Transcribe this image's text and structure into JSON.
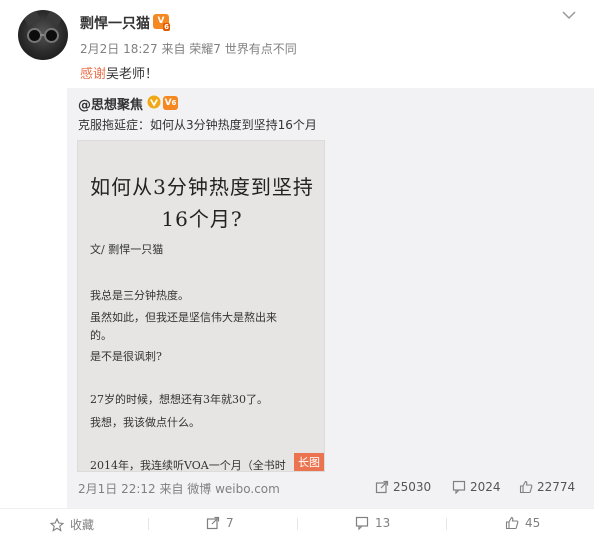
{
  "post": {
    "author": "剽悍一只猫",
    "vip_level": "6",
    "meta": "2月2日 18:27 来自 荣耀7 世界有点不同",
    "text_link": "感谢",
    "text_rest": "吴老师！"
  },
  "repost": {
    "author": "@思想聚焦",
    "vip_level": "6",
    "text": "克服拖延症：如何从3分钟热度到坚持16个月",
    "image": {
      "title_line1": "如何从3分钟热度到坚持",
      "title_line2": "16个月?",
      "lines": [
        "文/ 剽悍一只猫",
        "我总是三分钟热度。",
        "虽然如此，但我还是坚信伟大是熬出来",
        "的。",
        "是不是很讽刺?",
        "27岁的时候，想想还有3年就30了。",
        "我想，我该做点什么。",
        "2014年，我连续听VOA一个月（全书时"
      ],
      "tag": "长图"
    },
    "meta": "2月1日 22:12 来自 微博 weibo.com",
    "reposts": "25030",
    "comments": "2024",
    "likes": "22774"
  },
  "actions": {
    "favorite": "收藏",
    "repost": "7",
    "comment": "13",
    "like": "45"
  },
  "colors": {
    "link": "#eb7350",
    "vip": "#f58820",
    "verified": "#f0a816"
  },
  "icons": [
    "chevron-down-icon",
    "verified-v-icon",
    "share-icon",
    "comment-icon",
    "like-icon",
    "star-icon"
  ]
}
